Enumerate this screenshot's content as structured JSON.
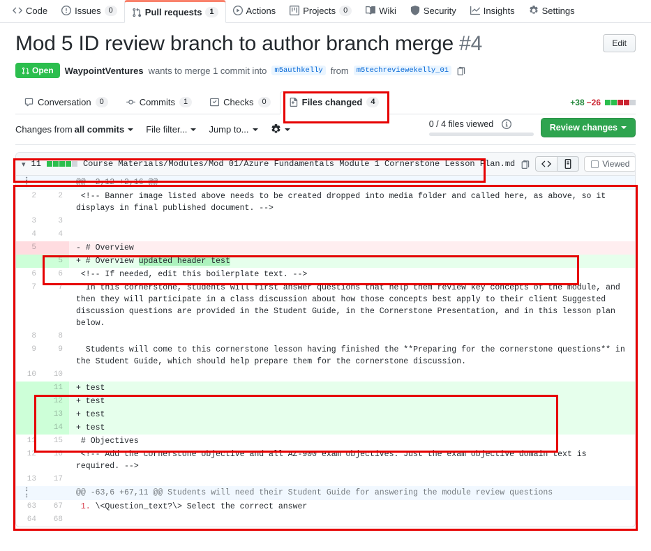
{
  "repo_nav": {
    "items": [
      {
        "label": "Code",
        "icon": "code-icon",
        "count": null,
        "selected": false
      },
      {
        "label": "Issues",
        "icon": "issue-icon",
        "count": "0",
        "selected": false
      },
      {
        "label": "Pull requests",
        "icon": "pr-icon",
        "count": "1",
        "selected": true
      },
      {
        "label": "Actions",
        "icon": "play-icon",
        "count": null,
        "selected": false
      },
      {
        "label": "Projects",
        "icon": "project-icon",
        "count": "0",
        "selected": false
      },
      {
        "label": "Wiki",
        "icon": "book-icon",
        "count": null,
        "selected": false
      },
      {
        "label": "Security",
        "icon": "shield-icon",
        "count": null,
        "selected": false
      },
      {
        "label": "Insights",
        "icon": "graph-icon",
        "count": null,
        "selected": false
      },
      {
        "label": "Settings",
        "icon": "gear-icon",
        "count": null,
        "selected": false
      }
    ]
  },
  "pr": {
    "title": "Mod 5 ID review branch to author branch merge",
    "number": "#4",
    "edit_label": "Edit",
    "state": "Open",
    "author": "WaypointVentures",
    "sub_text_1": "wants to merge 1 commit into",
    "base_branch": "m5authkelly",
    "sub_text_2": "from",
    "head_branch": "m5techreviewekelly_01"
  },
  "pr_tabs": {
    "items": [
      {
        "label": "Conversation",
        "icon": "comment-icon",
        "count": "0",
        "selected": false
      },
      {
        "label": "Commits",
        "icon": "commit-icon",
        "count": "1",
        "selected": false
      },
      {
        "label": "Checks",
        "icon": "checks-icon",
        "count": "0",
        "selected": false
      },
      {
        "label": "Files changed",
        "icon": "file-diff-icon",
        "count": "4",
        "selected": true
      }
    ],
    "additions": "+38",
    "deletions": "−26",
    "blocks": [
      "a",
      "a",
      "d",
      "d",
      "n"
    ]
  },
  "toolbar": {
    "changes_from_prefix": "Changes from",
    "changes_from_value": "all commits",
    "file_filter": "File filter...",
    "jump_to": "Jump to...",
    "gear_icon": "gear-icon",
    "files_viewed": "0 / 4 files viewed",
    "info_icon": "info-icon",
    "review_changes": "Review changes"
  },
  "file": {
    "chevron_icon": "chevron-down-icon",
    "change_count": "11",
    "blocks": [
      "a",
      "a",
      "a",
      "a",
      "n"
    ],
    "path": "Course Materials/Modules/Mod 01/Azure Fundamentals Module 1 Cornerstone Lesson Plan.md",
    "copy_icon": "copy-path-icon",
    "view_code_icon": "code-view-icon",
    "view_rich_icon": "rich-diff-icon",
    "viewed_label": "Viewed",
    "kebab_icon": "kebab-menu-icon"
  },
  "diff_rows": [
    {
      "type": "hunk",
      "old": "",
      "new": "",
      "text": "@@ -2,12 +2,16 @@"
    },
    {
      "type": "ctx",
      "old": "2",
      "new": "2",
      "text": " <!-- Banner image listed above needs to be created dropped into media folder and called here, as above, so it displays in final published document. -->"
    },
    {
      "type": "ctx",
      "old": "3",
      "new": "3",
      "text": ""
    },
    {
      "type": "ctx",
      "old": "4",
      "new": "4",
      "text": ""
    },
    {
      "type": "del",
      "old": "5",
      "new": "",
      "text": "- # Overview"
    },
    {
      "type": "add",
      "old": "",
      "new": "5",
      "text": "+ # Overview ",
      "highlight": "updated header test"
    },
    {
      "type": "ctx",
      "old": "6",
      "new": "6",
      "text": " <!-- If needed, edit this boilerplate text. -->"
    },
    {
      "type": "ctx",
      "old": "7",
      "new": "7",
      "text": "  In this cornerstone, students will first answer questions that help them review key concepts of the module, and then they will participate in a class discussion about how those concepts best apply to their client Suggested discussion questions are provided in the Student Guide, in the Cornerstone Presentation, and in this lesson plan below."
    },
    {
      "type": "ctx",
      "old": "8",
      "new": "8",
      "text": ""
    },
    {
      "type": "ctx",
      "old": "9",
      "new": "9",
      "text": "  Students will come to this cornerstone lesson having finished the **Preparing for the cornerstone questions** in the Student Guide, which should help prepare them for the cornerstone discussion."
    },
    {
      "type": "ctx",
      "old": "10",
      "new": "10",
      "text": ""
    },
    {
      "type": "add",
      "old": "",
      "new": "11",
      "text": "+ test"
    },
    {
      "type": "add",
      "old": "",
      "new": "12",
      "text": "+ test"
    },
    {
      "type": "add",
      "old": "",
      "new": "13",
      "text": "+ test"
    },
    {
      "type": "add",
      "old": "",
      "new": "14",
      "text": "+ test"
    },
    {
      "type": "ctx",
      "old": "11",
      "new": "15",
      "text": " # Objectives"
    },
    {
      "type": "ctx",
      "old": "12",
      "new": "16",
      "text": " <!-- Add the cornerstone objective and all AZ-900 exam objectives. Just the exam objective domain text is required. -->"
    },
    {
      "type": "ctx",
      "old": "13",
      "new": "17",
      "text": ""
    },
    {
      "type": "hunk",
      "old": "",
      "new": "",
      "text": "@@ -63,6 +67,11 @@ Students will need their Student Guide for answering the module review questions"
    },
    {
      "type": "ctx",
      "old": "63",
      "new": "67",
      "text": " 1. \\<Question_text?\\> Select the correct answer",
      "num_prefix": "1."
    },
    {
      "type": "ctx",
      "old": "64",
      "new": "68",
      "text": ""
    }
  ]
}
